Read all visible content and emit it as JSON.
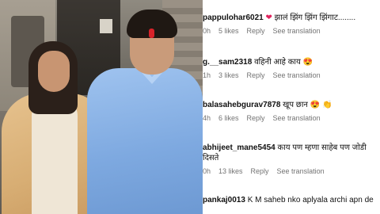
{
  "comments": [
    {
      "user": "pappulohar6021",
      "emoji": "❤",
      "text": "झालं झिंग झिंग झिंगाट........",
      "time": "0h",
      "likes": "5 likes",
      "reply": "Reply",
      "see_translation": "See translation"
    },
    {
      "user": "g.__sam2318",
      "text": "वहिनी आहे काय",
      "emoji": "😍",
      "time": "1h",
      "likes": "3 likes",
      "reply": "Reply",
      "see_translation": "See translation"
    },
    {
      "user": "balasahebgurav7878",
      "text": "खूप छान",
      "emoji": "😍 👏",
      "time": "4h",
      "likes": "6 likes",
      "reply": "Reply",
      "see_translation": "See translation"
    },
    {
      "user": "abhijeet_mane5454",
      "text": "काय पण म्हणा साहेब पण जोडी दिसते",
      "time": "0h",
      "likes": "13 likes",
      "reply": "Reply",
      "see_translation": "See translation"
    },
    {
      "user": "pankaj0013",
      "text": "K M saheb nko aplyala archi apn de"
    }
  ]
}
